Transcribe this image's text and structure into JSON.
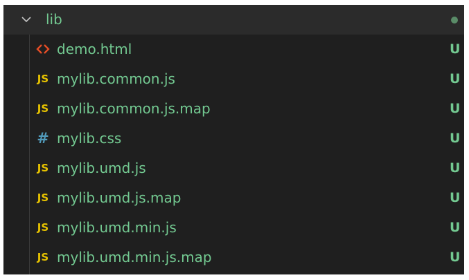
{
  "explorer": {
    "folder": {
      "name": "lib",
      "expanded": true,
      "chevron_icon": "chevron-down-icon",
      "decoration": "modified-dot"
    },
    "files": [
      {
        "name": "demo.html",
        "icon": "html-file-icon",
        "icon_glyph": "<>",
        "status": "U"
      },
      {
        "name": "mylib.common.js",
        "icon": "js-file-icon",
        "icon_glyph": "JS",
        "status": "U"
      },
      {
        "name": "mylib.common.js.map",
        "icon": "js-file-icon",
        "icon_glyph": "JS",
        "status": "U"
      },
      {
        "name": "mylib.css",
        "icon": "css-file-icon",
        "icon_glyph": "#",
        "status": "U"
      },
      {
        "name": "mylib.umd.js",
        "icon": "js-file-icon",
        "icon_glyph": "JS",
        "status": "U"
      },
      {
        "name": "mylib.umd.js.map",
        "icon": "js-file-icon",
        "icon_glyph": "JS",
        "status": "U"
      },
      {
        "name": "mylib.umd.min.js",
        "icon": "js-file-icon",
        "icon_glyph": "JS",
        "status": "U"
      },
      {
        "name": "mylib.umd.min.js.map",
        "icon": "js-file-icon",
        "icon_glyph": "JS",
        "status": "U"
      }
    ]
  },
  "colors": {
    "untracked_text": "#73c991",
    "background": "#1f1f1f",
    "folder_row_bg": "#2b2b2b",
    "js_icon": "#e6c200",
    "html_icon": "#e44d26",
    "css_icon": "#519aba"
  }
}
